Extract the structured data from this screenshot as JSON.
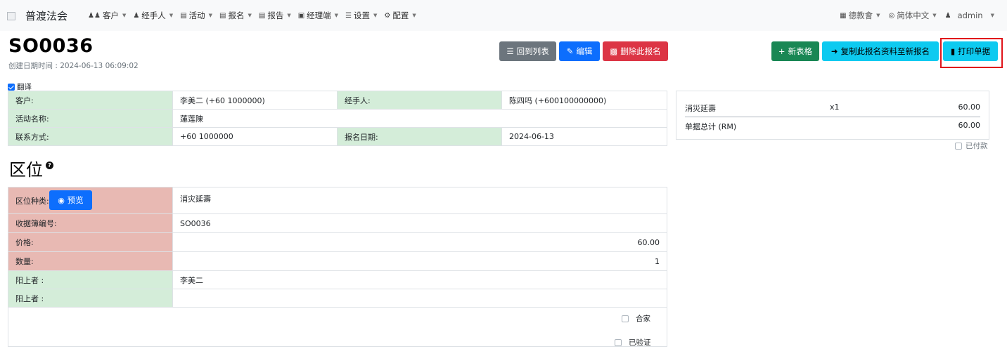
{
  "nav": {
    "brand": "普渡法会",
    "menu": [
      {
        "label": "客户",
        "icon": "users-icon"
      },
      {
        "label": "经手人",
        "icon": "user-icon"
      },
      {
        "label": "活动",
        "icon": "map-icon"
      },
      {
        "label": "报名",
        "icon": "file-icon"
      },
      {
        "label": "报告",
        "icon": "report-icon"
      },
      {
        "label": "经理端",
        "icon": "briefcase-icon"
      },
      {
        "label": "设置",
        "icon": "sliders-icon"
      },
      {
        "label": "配置",
        "icon": "cog-icon"
      }
    ],
    "right": {
      "org": "德教會",
      "language": "简体中文",
      "user": "admin"
    }
  },
  "header": {
    "title": "SO0036",
    "created": "创建日期时间 : 2024-06-13 06:09:02"
  },
  "buttons": {
    "back": "回到列表",
    "edit": "编辑",
    "delete": "删除此报名",
    "new_form": "新表格",
    "copy": "复制此报名资料至新报名",
    "print": "打印单据"
  },
  "translate_label": "翻译",
  "info": {
    "customer_label": "客户:",
    "customer_value": "李美二 (+60 1000000)",
    "handler_label": "经手人:",
    "handler_value": "陈四吗 (+600100000000)",
    "activity_label": "活动名称:",
    "activity_value": "蓮莲陳",
    "contact_label": "联系方式:",
    "contact_value": "+60 1000000",
    "date_label": "报名日期:",
    "date_value": "2024-06-13"
  },
  "section_title": "区位",
  "slot": {
    "type_label": "区位种类:",
    "preview_label": "预览",
    "type_value": "消灾延壽",
    "receipt_label": "收据簿编号:",
    "receipt_value": "SO0036",
    "price_label": "价格:",
    "price_value": "60.00",
    "qty_label": "数量:",
    "qty_value": "1",
    "living1_label": "阳上者 :",
    "living1_value": "李美二",
    "living2_label": "阳上者 :",
    "living2_value": "",
    "family_label": "合家",
    "verified_label": "已验证"
  },
  "summary": {
    "item_name": "消災延壽",
    "item_qty": "x1",
    "item_amount": "60.00",
    "total_label": "单据总计 (RM)",
    "total_amount": "60.00",
    "paid_label": "已付款"
  }
}
